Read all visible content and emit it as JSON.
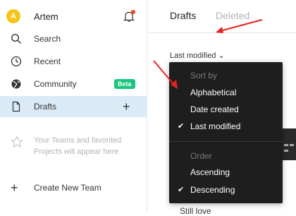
{
  "user": {
    "initial": "A",
    "name": "Artem"
  },
  "sidebar": {
    "items": [
      {
        "label": "Search",
        "icon": "search-icon"
      },
      {
        "label": "Recent",
        "icon": "clock-icon"
      },
      {
        "label": "Community",
        "icon": "globe-icon",
        "badge": "Beta"
      },
      {
        "label": "Drafts",
        "icon": "file-icon",
        "action": "+"
      }
    ],
    "teams_empty": "Your Teams and favorited Projects will appear here",
    "create_team": "Create New Team"
  },
  "main": {
    "tabs": [
      "Drafts",
      "Deleted"
    ],
    "sort_label": "Last modified ⌄",
    "partial_text": "Still love"
  },
  "dropdown": {
    "sort_header": "Sort by",
    "sort_options": [
      "Alphabetical",
      "Date created",
      "Last modified"
    ],
    "sort_selected": "Last modified",
    "order_header": "Order",
    "order_options": [
      "Ascending",
      "Descending"
    ],
    "order_selected": "Descending",
    "check": "✔"
  },
  "colors": {
    "accent": "#daebf7",
    "badge": "#1bc47d",
    "avatar": "#f5c518",
    "notification": "#f24822",
    "menu_bg": "#1e1e1e",
    "annotation": "#e8211c"
  }
}
